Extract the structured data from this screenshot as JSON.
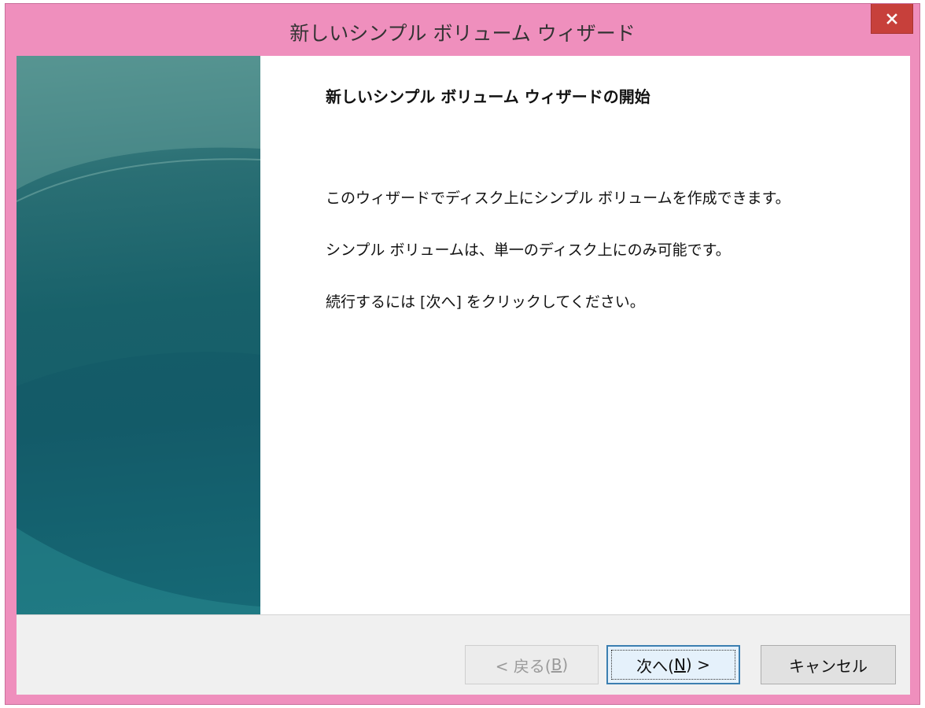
{
  "window": {
    "title": "新しいシンプル ボリューム ウィザード",
    "close_icon": "close-icon"
  },
  "content": {
    "heading": "新しいシンプル ボリューム ウィザードの開始",
    "paragraphs": [
      "このウィザードでディスク上にシンプル ボリュームを作成できます。",
      "シンプル ボリュームは、単一のディスク上にのみ可能です。",
      "続行するには [次へ] をクリックしてください。"
    ]
  },
  "buttons": {
    "back": {
      "prefix": "< 戻る(",
      "key": "B",
      "suffix": ")",
      "enabled": false
    },
    "next": {
      "prefix": "次へ(",
      "key": "N",
      "suffix": ") >",
      "enabled": true
    },
    "cancel": {
      "label": "キャンセル",
      "enabled": true
    }
  },
  "colors": {
    "title_bar": "#ef8fbd",
    "close_button": "#c7403b",
    "left_panel": "#18616a",
    "default_button_border": "#3c7fb1"
  }
}
